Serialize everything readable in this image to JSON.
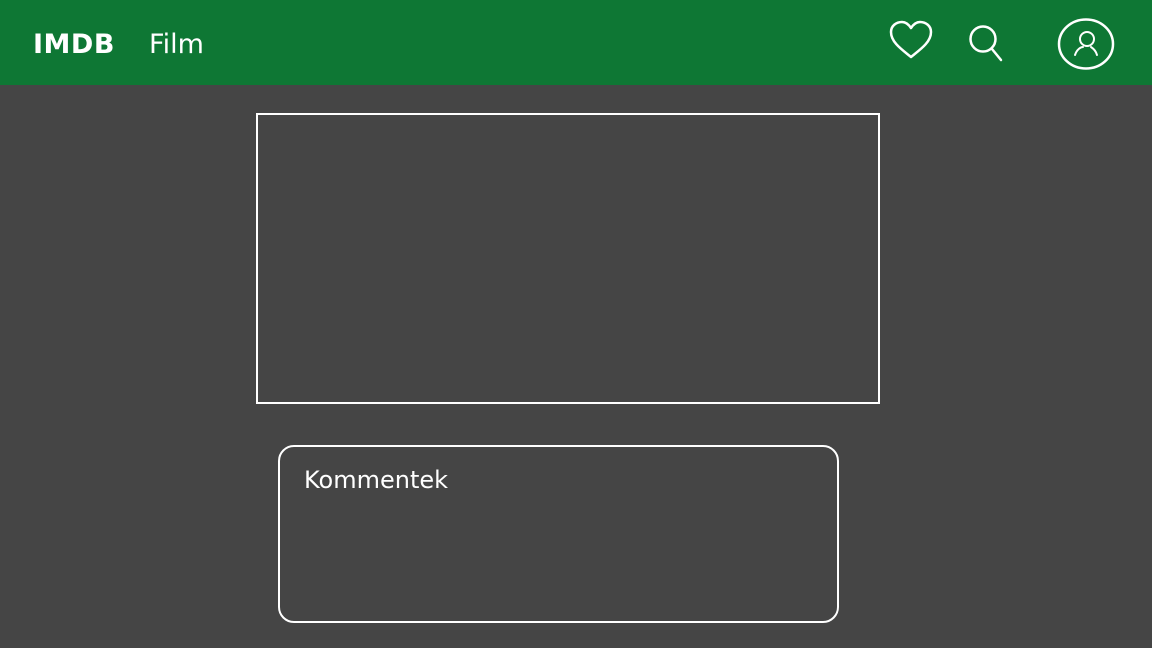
{
  "header": {
    "brand": "IMDB",
    "nav_film": "Film",
    "icons": [
      "heart-icon",
      "search-icon",
      "user-profile-icon"
    ]
  },
  "main": {
    "comments_title": "Kommentek"
  },
  "colors": {
    "header_bg": "#0e7734",
    "page_bg": "#454545",
    "foreground": "#ffffff"
  }
}
